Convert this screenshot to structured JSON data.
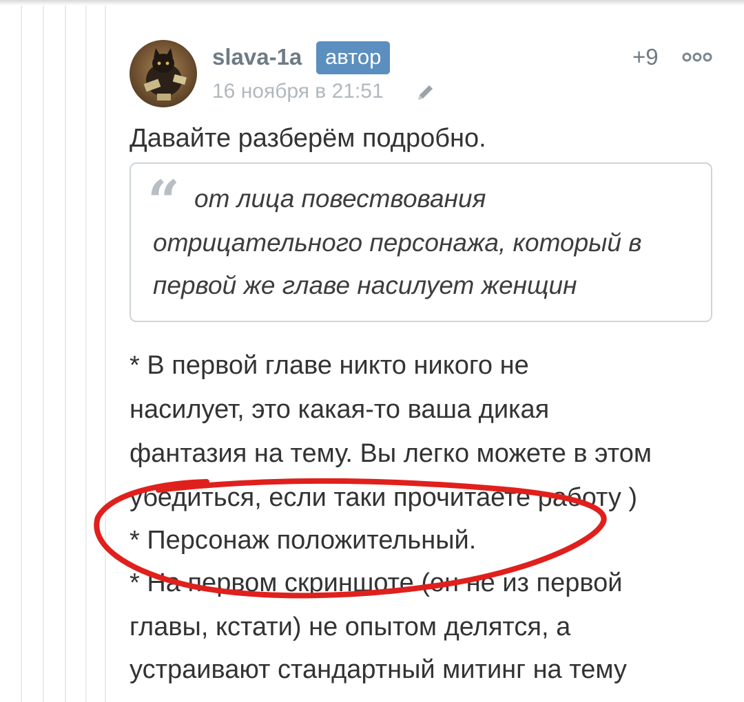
{
  "comment": {
    "username": "slava-1a",
    "author_badge": "автор",
    "datetime": "16 ноября в 21:51",
    "score": "+9",
    "icons": {
      "edit": "pencil-icon",
      "more": "more-dots-icon",
      "quote": "quote-mark-icon"
    },
    "intro": "Давайте разберём подробно.",
    "quote_lines": [
      "от лица повествования",
      "отрицательного персонажа, который в",
      "первой же главе насилует женщин"
    ],
    "body_lines": [
      "* В первой главе никто никого не",
      "насилует, это какая-то ваша дикая",
      "фантазия на тему. Вы легко можете в этом",
      "убедиться, если таки прочитаете работу )",
      "* Персонаж положительный.",
      "* На первом скриншоте (он не из первой",
      "главы, кстати) не опытом делятся, а",
      "устраивают стандартный митинг на тему"
    ]
  },
  "colors": {
    "badge": "#5b8fbf",
    "username": "#6e7b86",
    "meta": "#b0b8be",
    "text": "#333333",
    "annotation": "#e0201c"
  }
}
